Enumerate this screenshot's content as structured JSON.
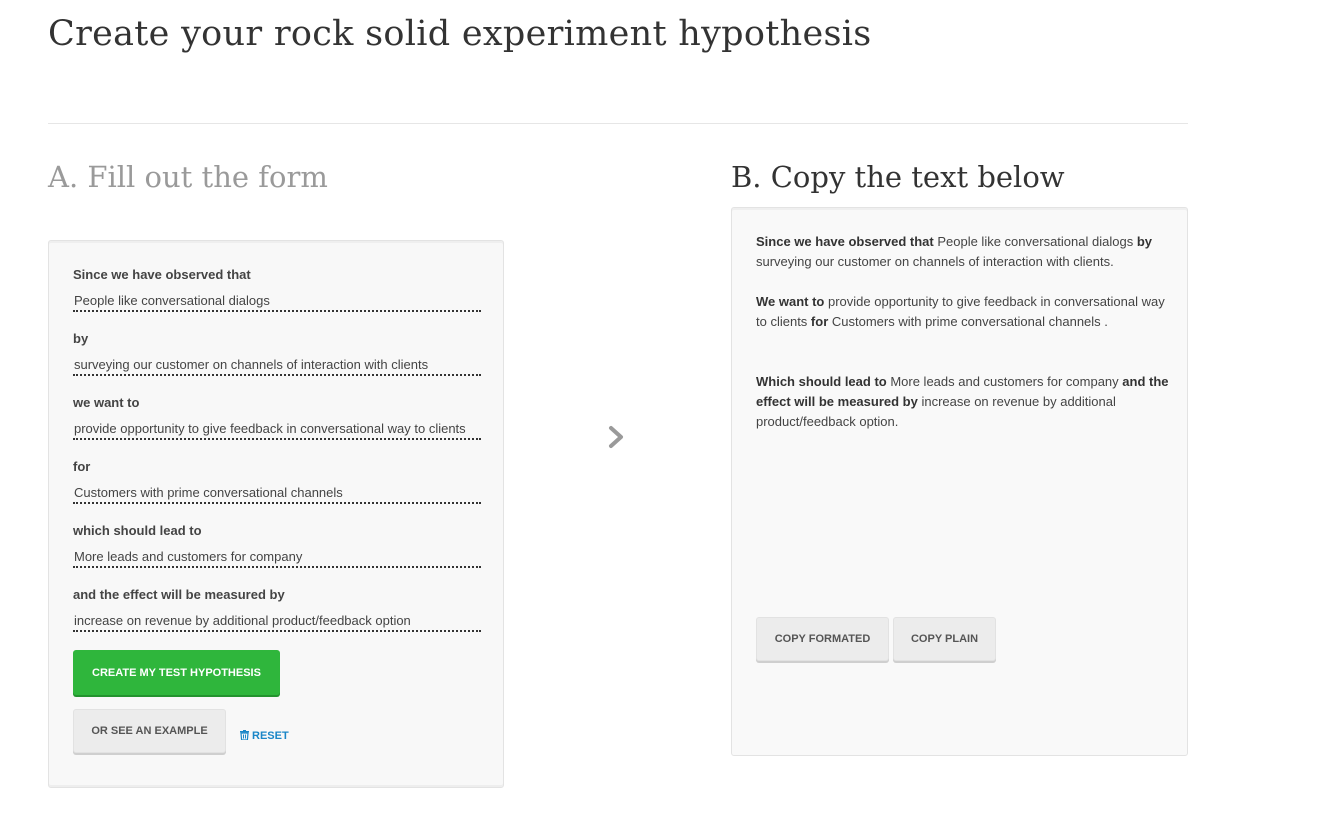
{
  "page": {
    "title": "Create your rock solid experiment hypothesis"
  },
  "section_a": {
    "title": "A. Fill out the form",
    "fields": [
      {
        "label": "Since we have observed that",
        "value": "People like conversational dialogs"
      },
      {
        "label": "by",
        "value": "surveying our customer on channels of interaction with clients"
      },
      {
        "label": "we want to",
        "value": "provide opportunity to give feedback in conversational way to clients"
      },
      {
        "label": "for",
        "value": "Customers with prime conversational channels"
      },
      {
        "label": "which should lead to",
        "value": "More leads and customers for company"
      },
      {
        "label": "and the effect will be measured by",
        "value": "increase on revenue by additional product/feedback option"
      }
    ],
    "create_button": "CREATE MY TEST HYPOTHESIS",
    "example_button": "OR SEE AN EXAMPLE",
    "reset_link": "RESET"
  },
  "arrow_icon": "chevron-right-icon",
  "section_b": {
    "title": "B. Copy the text below",
    "output": {
      "p1": {
        "k1": "Since we have observed that",
        "v1": " People like conversational dialogs ",
        "k2": "by",
        "v2": " surveying our customer on channels of interaction with clients."
      },
      "p2": {
        "k1": "We want to",
        "v1": " provide opportunity to give feedback in conversational way to clients ",
        "k2": "for",
        "v2": " Customers with prime conversational channels ."
      },
      "p3": {
        "k1": "Which should lead to",
        "v1": " More leads and customers for company ",
        "k2": "and the effect will be measured by",
        "v2": " increase on revenue by additional product/feedback option."
      }
    },
    "copy_formatted_button": "COPY FORMATED",
    "copy_plain_button": "COPY PLAIN"
  },
  "colors": {
    "primary_green": "#2fb63c",
    "link_blue": "#1a86c7",
    "muted_title": "#9a9a9a",
    "panel_bg": "#f8f8f8"
  }
}
